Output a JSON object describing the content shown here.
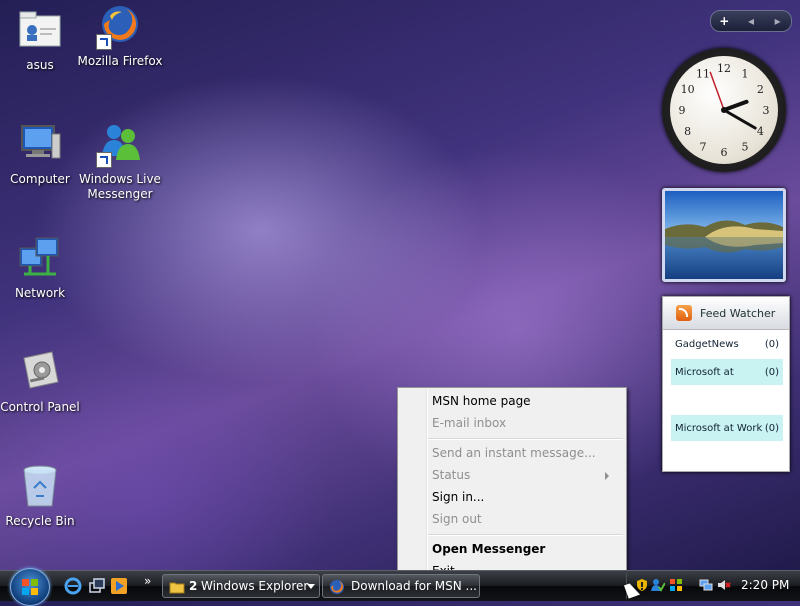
{
  "desktop": {
    "icons": [
      {
        "label": "asus",
        "icon": "user-folder-icon"
      },
      {
        "label": "Mozilla Firefox",
        "icon": "firefox-icon"
      },
      {
        "label": "Computer",
        "icon": "computer-icon"
      },
      {
        "label": "Windows Live Messenger",
        "icon": "messenger-icon"
      },
      {
        "label": "Network",
        "icon": "network-icon"
      },
      {
        "label": "Control Panel",
        "icon": "control-panel-icon"
      },
      {
        "label": "Recycle Bin",
        "icon": "recycle-bin-icon"
      }
    ]
  },
  "sidebar": {
    "add_label": "+",
    "prev_label": "◂",
    "next_label": "▸",
    "clock": {
      "numerals": [
        "12",
        "1",
        "2",
        "3",
        "4",
        "5",
        "6",
        "7",
        "8",
        "9",
        "10",
        "11"
      ],
      "hour": 2,
      "minute": 20
    },
    "feed_watcher": {
      "title": "Feed Watcher",
      "feeds": [
        {
          "name": "GadgetNews",
          "count": "(0)",
          "highlight": false
        },
        {
          "name": "Microsoft at",
          "count": "(0)",
          "highlight": true
        },
        {
          "name": "Microsoft at Work",
          "count": "(0)",
          "highlight": true
        }
      ]
    }
  },
  "context_menu": {
    "items": [
      {
        "label": "MSN home page",
        "state": "enabled"
      },
      {
        "label": "E-mail inbox",
        "state": "disabled"
      },
      {
        "label": "Send an instant message...",
        "state": "disabled"
      },
      {
        "label": "Status",
        "state": "disabled",
        "submenu": true
      },
      {
        "label": "Sign in...",
        "state": "enabled"
      },
      {
        "label": "Sign out",
        "state": "disabled"
      },
      {
        "label": "Open Messenger",
        "state": "default"
      },
      {
        "label": "Exit",
        "state": "enabled"
      }
    ]
  },
  "taskbar": {
    "quick_launch_more": "»",
    "buttons": [
      {
        "count": "2",
        "label": "Windows Explorer",
        "icon": "folder-icon"
      },
      {
        "label": "Download for MSN ...",
        "icon": "firefox-icon"
      }
    ],
    "tray": {
      "time": "2:20 PM"
    }
  },
  "colors": {
    "menu_background": "#f0f0f0",
    "menu_disabled_text": "#8f8f8f",
    "feed_highlight": "#c9f2f2",
    "taskbar": "#1b1d22"
  }
}
